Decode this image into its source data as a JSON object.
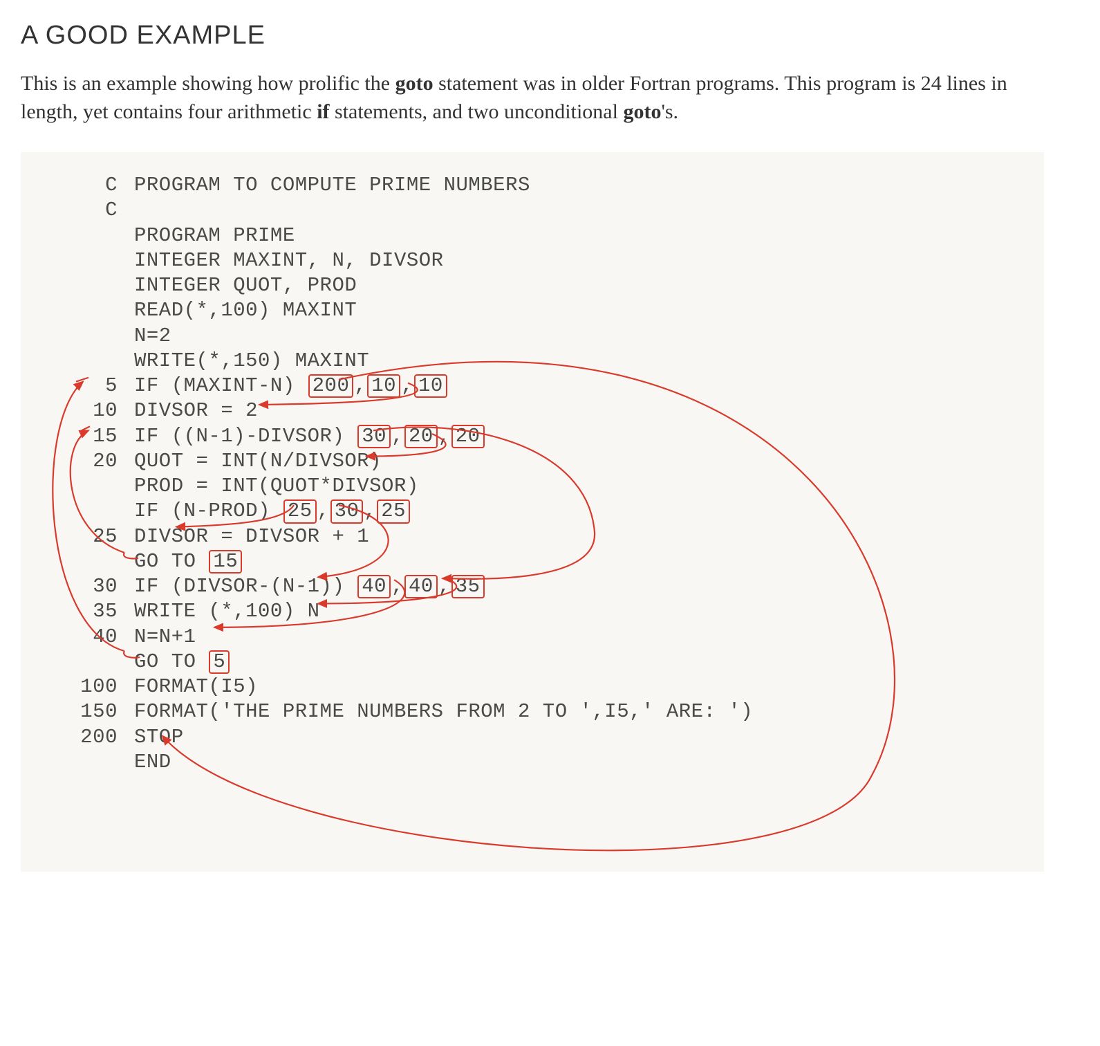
{
  "heading": "A GOOD EXAMPLE",
  "intro_parts": {
    "p1": "This is an example showing how prolific the ",
    "kw1": "goto",
    "p2": " statement was in older Fortran programs. This program is 24 lines in length, yet contains four arithmetic ",
    "kw2": "if",
    "p3": " statements, and two unconditional ",
    "kw3": "goto",
    "p4": "'s."
  },
  "annotation_color": "#d93a2b",
  "code": {
    "lines": [
      {
        "label": "C",
        "text": "PROGRAM TO COMPUTE PRIME NUMBERS",
        "boxes": []
      },
      {
        "label": "C",
        "text": "",
        "boxes": []
      },
      {
        "label": "",
        "text": "PROGRAM PRIME",
        "boxes": []
      },
      {
        "label": "",
        "text": "INTEGER MAXINT, N, DIVSOR",
        "boxes": []
      },
      {
        "label": "",
        "text": "INTEGER QUOT, PROD",
        "boxes": []
      },
      {
        "label": "",
        "text": "READ(*,100) MAXINT",
        "boxes": []
      },
      {
        "label": "",
        "text": "N=2",
        "boxes": []
      },
      {
        "label": "",
        "text": "WRITE(*,150) MAXINT",
        "boxes": []
      },
      {
        "label": "5",
        "text": "IF (MAXINT-N) ",
        "boxes": [
          "200",
          "10",
          "10"
        ]
      },
      {
        "label": "10",
        "text": "DIVSOR = 2",
        "boxes": []
      },
      {
        "label": "15",
        "text": "IF ((N-1)-DIVSOR) ",
        "boxes": [
          "30",
          "20",
          "20"
        ]
      },
      {
        "label": "20",
        "text": "QUOT = INT(N/DIVSOR)",
        "boxes": []
      },
      {
        "label": "",
        "text": "PROD = INT(QUOT*DIVSOR)",
        "boxes": []
      },
      {
        "label": "",
        "text": "IF (N-PROD) ",
        "boxes": [
          "25",
          "30",
          "25"
        ]
      },
      {
        "label": "25",
        "text": "DIVSOR = DIVSOR + 1",
        "boxes": []
      },
      {
        "label": "",
        "text": "GO TO ",
        "boxes": [
          "15"
        ]
      },
      {
        "label": "30",
        "text": "IF (DIVSOR-(N-1)) ",
        "boxes": [
          "40",
          "40",
          "35"
        ]
      },
      {
        "label": "35",
        "text": "WRITE (*,100) N",
        "boxes": []
      },
      {
        "label": "40",
        "text": "N=N+1",
        "boxes": []
      },
      {
        "label": "",
        "text": "GO TO ",
        "boxes": [
          "5"
        ]
      },
      {
        "label": "100",
        "text": "FORMAT(I5)",
        "boxes": []
      },
      {
        "label": "150",
        "text": "FORMAT('THE PRIME NUMBERS FROM 2 TO ',I5,' ARE: ')",
        "boxes": []
      },
      {
        "label": "200",
        "text": "STOP",
        "boxes": []
      },
      {
        "label": "",
        "text": "END",
        "boxes": []
      }
    ]
  }
}
